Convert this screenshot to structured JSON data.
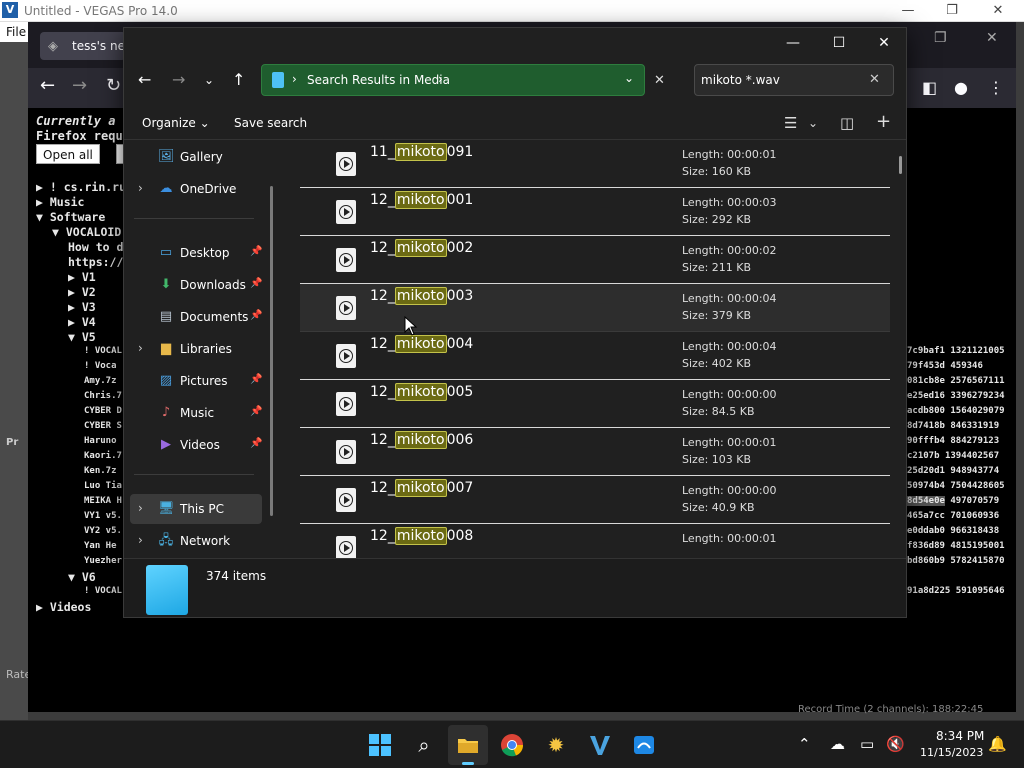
{
  "vegas": {
    "title": "Untitled - VEGAS Pro 14.0",
    "menu_file": "File",
    "rate_label": "Rate",
    "panel_label": "Pr"
  },
  "firefox": {
    "tab_label": "tess's new",
    "notice_line1": "Currently a",
    "notice_line2": "Firefox requ",
    "open_all_label": "Open all",
    "tree": {
      "cs_rin": "! cs.rin.ru",
      "music": "Music",
      "software": "Software",
      "vocaloid": "VOCALOID",
      "howto": "How to d",
      "https": "https://",
      "v1": "V1",
      "v2": "V2",
      "v3": "V3",
      "v4": "V4",
      "v5": "V5",
      "v5_items": [
        "! VOCAL",
        "! Voca",
        "Amy.7z",
        "Chris.7",
        "CYBER D",
        "CYBER S",
        "Haruno",
        "Kaori.7",
        "Ken.7z",
        "Luo Tia",
        "MEIKA H",
        "VY1 v5.",
        "VY2 v5.",
        "Yan He",
        "Yuezher"
      ],
      "v6": "V6",
      "v6_items": [
        "! VOCAL"
      ],
      "videos": "Videos"
    },
    "hash_rows": [
      {
        "hash": "7c9baf1",
        "size": "1321121005"
      },
      {
        "hash": "79f453d",
        "size": "459346"
      },
      {
        "hash": "081cb8e",
        "size": "2576567111"
      },
      {
        "hash": "e25ed16",
        "size": "3396279234"
      },
      {
        "hash": "acdb800",
        "size": "1564029079"
      },
      {
        "hash": "8d7418b",
        "size": "846331919"
      },
      {
        "hash": "90fffb4",
        "size": "884279123"
      },
      {
        "hash": "c2107b",
        "size": "1394402567"
      },
      {
        "hash": "25d20d1",
        "size": "948943774"
      },
      {
        "hash": "50974b4",
        "size": "7504428605"
      },
      {
        "hash": "8d54e0e",
        "size": "497070579"
      },
      {
        "hash": "465a7cc",
        "size": "701060936"
      },
      {
        "hash": "e0ddab0",
        "size": "966318438"
      },
      {
        "hash": "f836d89",
        "size": "4815195001"
      },
      {
        "hash": "bd860b9",
        "size": "5782415870"
      },
      {
        "hash": "91a8d225",
        "size": "591095646"
      }
    ],
    "footer_text": "Record Time (2 channels): 188:22:45"
  },
  "explorer": {
    "address": "Search Results in Media",
    "search_value": "mikoto *.wav",
    "cmd": {
      "organize": "Organize",
      "save_search": "Save search"
    },
    "nav": [
      {
        "label": "Gallery",
        "icon": "gallery-icon",
        "glyph": "🖼",
        "color": "#5ab0e8",
        "chevron": false,
        "pin": false
      },
      {
        "label": "OneDrive",
        "icon": "onedrive-icon",
        "glyph": "☁",
        "color": "#3b8fe0",
        "chevron": true,
        "pin": false
      },
      {
        "label": "Desktop",
        "icon": "desktop-icon",
        "glyph": "▭",
        "color": "#4aa3df",
        "chevron": false,
        "pin": true
      },
      {
        "label": "Downloads",
        "icon": "downloads-icon",
        "glyph": "⬇",
        "color": "#42b86a",
        "chevron": false,
        "pin": true
      },
      {
        "label": "Documents",
        "icon": "documents-icon",
        "glyph": "▤",
        "color": "#b8c4d0",
        "chevron": false,
        "pin": true
      },
      {
        "label": "Libraries",
        "icon": "libraries-icon",
        "glyph": "▆",
        "color": "#e8b84a",
        "chevron": true,
        "pin": false
      },
      {
        "label": "Pictures",
        "icon": "pictures-icon",
        "glyph": "▨",
        "color": "#4a9fe0",
        "chevron": false,
        "pin": true
      },
      {
        "label": "Music",
        "icon": "music-icon",
        "glyph": "♪",
        "color": "#e06a6a",
        "chevron": false,
        "pin": true
      },
      {
        "label": "Videos",
        "icon": "videos-icon",
        "glyph": "▶",
        "color": "#9a6ae0",
        "chevron": false,
        "pin": true
      },
      {
        "label": "This PC",
        "icon": "this-pc-icon",
        "glyph": "🖥",
        "color": "#4ab0e0",
        "chevron": true,
        "pin": false
      },
      {
        "label": "Network",
        "icon": "network-icon",
        "glyph": "🖧",
        "color": "#4ab0e0",
        "chevron": true,
        "pin": false
      }
    ],
    "files": [
      {
        "prefix": "11_",
        "match": "mikoto",
        "suffix": "091",
        "length": "Length: 00:00:01",
        "size": "Size: 160 KB"
      },
      {
        "prefix": "12_",
        "match": "mikoto",
        "suffix": "001",
        "length": "Length: 00:00:03",
        "size": "Size: 292 KB"
      },
      {
        "prefix": "12_",
        "match": "mikoto",
        "suffix": "002",
        "length": "Length: 00:00:02",
        "size": "Size: 211 KB"
      },
      {
        "prefix": "12_",
        "match": "mikoto",
        "suffix": "003",
        "length": "Length: 00:00:04",
        "size": "Size: 379 KB"
      },
      {
        "prefix": "12_",
        "match": "mikoto",
        "suffix": "004",
        "length": "Length: 00:00:04",
        "size": "Size: 402 KB"
      },
      {
        "prefix": "12_",
        "match": "mikoto",
        "suffix": "005",
        "length": "Length: 00:00:00",
        "size": "Size: 84.5 KB"
      },
      {
        "prefix": "12_",
        "match": "mikoto",
        "suffix": "006",
        "length": "Length: 00:00:01",
        "size": "Size: 103 KB"
      },
      {
        "prefix": "12_",
        "match": "mikoto",
        "suffix": "007",
        "length": "Length: 00:00:00",
        "size": "Size: 40.9 KB"
      },
      {
        "prefix": "12_",
        "match": "mikoto",
        "suffix": "008",
        "length": "Length: 00:00:01",
        "size": ""
      }
    ],
    "item_count": "374 items"
  },
  "taskbar": {
    "time": "8:34 PM",
    "date": "11/15/2023",
    "accent": "#60cdff"
  }
}
